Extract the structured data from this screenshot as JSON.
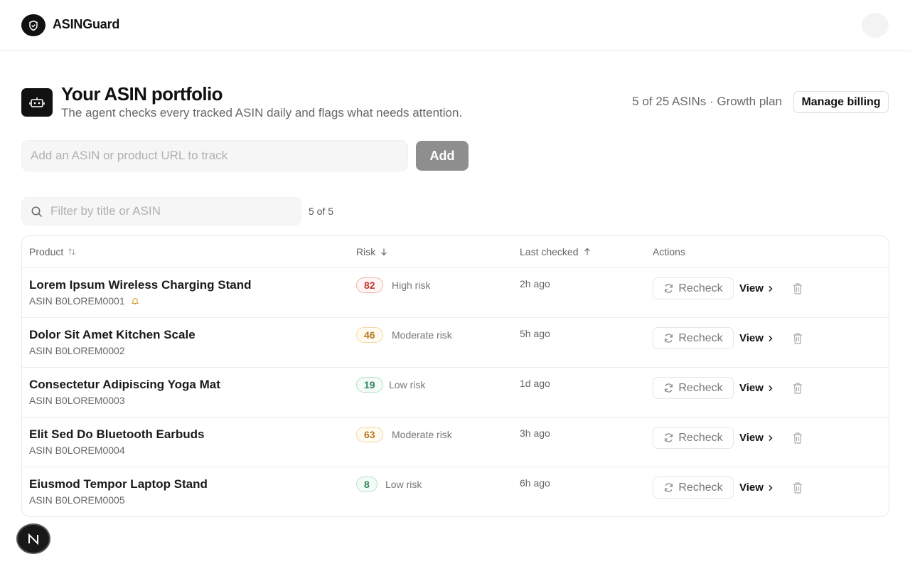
{
  "app": {
    "name": "ASINGuard"
  },
  "header": {
    "title": "Your ASIN portfolio",
    "subtitle": "The agent checks every tracked ASIN daily and flags what needs attention.",
    "plan_text": "5 of 25 ASINs · Growth plan",
    "billing_label": "Manage billing"
  },
  "add": {
    "placeholder": "Add an ASIN or product URL to track",
    "button_label": "Add"
  },
  "filter": {
    "placeholder": "Filter by title or ASIN",
    "count": "5 of 5"
  },
  "table": {
    "columns": {
      "product": "Product",
      "risk": "Risk",
      "last_checked": "Last checked",
      "actions": "Actions"
    },
    "recheck_label": "Recheck",
    "view_label": "View",
    "rows": [
      {
        "title": "Lorem Ipsum Wireless Charging Stand",
        "asin": "ASIN B0LOREM0001",
        "score": "82",
        "risk_label": "High risk",
        "level": "high",
        "checked": "2h ago",
        "alert": true
      },
      {
        "title": "Dolor Sit Amet Kitchen Scale",
        "asin": "ASIN B0LOREM0002",
        "score": "46",
        "risk_label": "Moderate risk",
        "level": "moderate",
        "checked": "5h ago",
        "alert": false
      },
      {
        "title": "Consectetur Adipiscing Yoga Mat",
        "asin": "ASIN B0LOREM0003",
        "score": "19",
        "risk_label": "Low risk",
        "level": "low",
        "checked": "1d ago",
        "alert": false
      },
      {
        "title": "Elit Sed Do Bluetooth Earbuds",
        "asin": "ASIN B0LOREM0004",
        "score": "63",
        "risk_label": "Moderate risk",
        "level": "moderate",
        "checked": "3h ago",
        "alert": false
      },
      {
        "title": "Eiusmod Tempor Laptop Stand",
        "asin": "ASIN B0LOREM0005",
        "score": "8",
        "risk_label": "Low risk",
        "level": "low",
        "checked": "6h ago",
        "alert": false
      }
    ]
  },
  "colors": {
    "high": {
      "text": "#c0392b",
      "border": "#f1b5ae",
      "bg": "#fff5f4"
    },
    "moderate": {
      "text": "#b7791f",
      "border": "#f3d9a6",
      "bg": "#fffaf0"
    },
    "low": {
      "text": "#2f855a",
      "border": "#b7e1c9",
      "bg": "#f3fbf6"
    }
  },
  "icons": {
    "brand": "shield-icon",
    "title": "robot-icon",
    "filter": "search-icon",
    "recheck": "refresh-icon",
    "view": "chevron-right-icon",
    "delete": "trash-icon",
    "alert": "bell-icon",
    "fab": "n-logo-icon"
  }
}
